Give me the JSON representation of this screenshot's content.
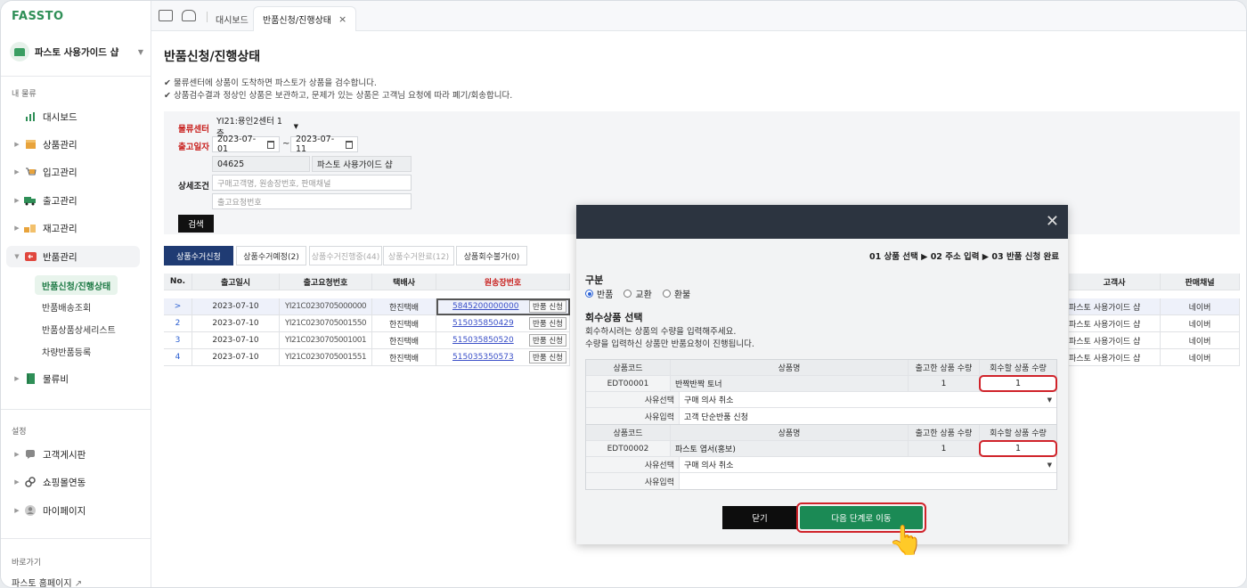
{
  "app": {
    "logo": "FASSTO",
    "shop_name": "파스토 사용가이드 샵"
  },
  "sidebar": {
    "section_logistics": "내 물류",
    "items": [
      {
        "label": "대시보드",
        "icon": "bar-chart-icon",
        "color": "#2f8f57"
      },
      {
        "label": "상품관리",
        "icon": "box-icon",
        "color": "#e8a33b"
      },
      {
        "label": "입고관리",
        "icon": "cart-icon",
        "color": "#e8a33b"
      },
      {
        "label": "출고관리",
        "icon": "truck-icon",
        "color": "#2f8f57"
      },
      {
        "label": "재고관리",
        "icon": "stock-icon",
        "color": "#e8a33b"
      },
      {
        "label": "반품관리",
        "icon": "return-icon",
        "color": "#e0473e"
      }
    ],
    "return_sub": [
      "반품신청/진행상태",
      "반품배송조회",
      "반품상품상세리스트",
      "차량반품등록"
    ],
    "fee": "물류비",
    "section_settings": "설정",
    "settings_items": [
      "고객게시판",
      "쇼핑몰연동",
      "마이페이지"
    ],
    "section_shortcut": "바로가기",
    "homepage": "파스토 홈페이지"
  },
  "topbar": {
    "tabs": [
      "대시보드",
      "반품신청/진행상태"
    ],
    "close": "×"
  },
  "page": {
    "title": "반품신청/진행상태",
    "notes": [
      "✔ 물류센터에 상품이 도착하면 파스토가 상품을 검수합니다.",
      "✔ 상품검수결과 정상인 상품은 보관하고, 문제가 있는 상품은 고객님 요청에 따라 폐기/회송합니다."
    ]
  },
  "filter": {
    "center_label": "물류센터",
    "center_value": "YI21:용인2센터 1층",
    "date_label": "출고일자",
    "date_from": "2023-07-01",
    "date_to": "2023-07-11",
    "tilde": "~",
    "code": "04625",
    "shop": "파스토 사용가이드 샵",
    "detail_label": "상세조건",
    "ph1": "구매고객명, 원송장번호, 판매채널",
    "ph2": "출고요청번호",
    "search_btn": "검색"
  },
  "status_tabs": [
    "상품수거신청",
    "상품수거예정(2)",
    "상품수거진행중(44)",
    "상품수거완료(12)",
    "상품회수불가(0)"
  ],
  "table": {
    "headers": [
      "No.",
      "출고일시",
      "출고요청번호",
      "택배사",
      "원송장번호"
    ],
    "right_headers": [
      "고객사",
      "판매채널"
    ],
    "btn": "반품 신청",
    "rows": [
      {
        "no": ">",
        "date": "2023-07-10",
        "req": "YI21C0230705000000",
        "courier": "한진택배",
        "inv": "5845200000000",
        "client": "파스토 사용가이드 샵",
        "channel": "네이버"
      },
      {
        "no": "2",
        "date": "2023-07-10",
        "req": "YI21C0230705001550",
        "courier": "한진택배",
        "inv": "515035850429",
        "client": "파스토 사용가이드 샵",
        "channel": "네이버"
      },
      {
        "no": "3",
        "date": "2023-07-10",
        "req": "YI21C0230705001001",
        "courier": "한진택배",
        "inv": "515035850520",
        "client": "파스토 사용가이드 샵",
        "channel": "네이버"
      },
      {
        "no": "4",
        "date": "2023-07-10",
        "req": "YI21C0230705001551",
        "courier": "한진택배",
        "inv": "515035350573",
        "client": "파스토 사용가이드 샵",
        "channel": "네이버"
      }
    ]
  },
  "modal": {
    "steps": "01 상품 선택 ▶ 02 주소 입력 ▶ 03 반품 신청 완료",
    "type_label": "구분",
    "types": [
      "반품",
      "교환",
      "환불"
    ],
    "select_label": "회수상품 선택",
    "desc1": "회수하시려는 상품의 수량을 입력해주세요.",
    "desc2": "수량을 입력하신 상품만 반품요청이 진행됩니다.",
    "col_code": "상품코드",
    "col_name": "상품명",
    "col_out": "출고한 상품 수량",
    "col_ret": "회수할 상품 수량",
    "reason_sel": "사유선택",
    "reason_in": "사유입력",
    "items": [
      {
        "code": "EDT00001",
        "name": "반짝반짝 토너",
        "out": "1",
        "ret": "1",
        "reason": "구매 의사 취소",
        "memo": "고객 단순반품 신청"
      },
      {
        "code": "EDT00002",
        "name": "파스토 엽서(홍보)",
        "out": "1",
        "ret": "1",
        "reason": "구매 의사 취소",
        "memo": ""
      }
    ],
    "btn_close": "닫기",
    "btn_next": "다음 단계로 이동"
  }
}
